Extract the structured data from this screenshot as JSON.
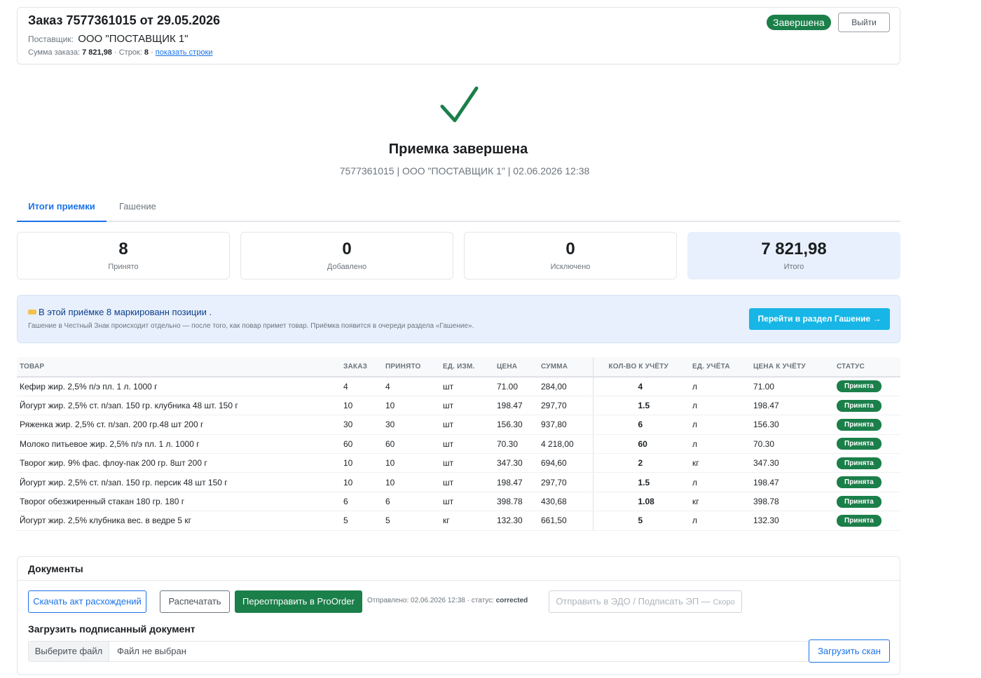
{
  "header": {
    "order_title": "Заказ 7577361015 от 29.05.2026",
    "supplier_label": "Поставщик:",
    "supplier_name": "ООО \"ПОСТАВЩИК 1\"",
    "sum_label": "Сумма заказа:",
    "sum_value": "7 821,98",
    "rows_label": "· Строк:",
    "rows_value": "8",
    "show_rows_link": "показать строки",
    "status": "Завершена",
    "logout": "Выйти"
  },
  "done": {
    "title": "Приемка завершена",
    "subtitle": "7577361015 | ООО \"ПОСТАВЩИК 1\" | 02.06.2026 12:38"
  },
  "tabs": [
    {
      "label": "Итоги приемки",
      "active": true
    },
    {
      "label": "Гашение",
      "active": false
    }
  ],
  "stats": [
    {
      "value": "8",
      "label": "Принято"
    },
    {
      "value": "0",
      "label": "Добавлено"
    },
    {
      "value": "0",
      "label": "Исключено"
    },
    {
      "value": "7 821,98",
      "label": "Итого"
    }
  ],
  "banner": {
    "line1": "В этой приёмке 8 маркированн позиции .",
    "line2": "Гашение в Честный Знак происходит отдельно — после того, как повар примет товар. Приёмка появится в очереди раздела «Гашение».",
    "button": "Перейти в раздел Гашение →"
  },
  "table": {
    "headers": [
      "ТОВАР",
      "ЗАКАЗ",
      "ПРИНЯТО",
      "ЕД. ИЗМ.",
      "ЦЕНА",
      "СУММА",
      "КОЛ-ВО К УЧЁТУ",
      "ЕД. УЧЁТА",
      "ЦЕНА К УЧЁТУ",
      "СТАТУС"
    ],
    "rows": [
      {
        "name": "Кефир жир. 2,5% п/э пл. 1 л. 1000 г",
        "order": "4",
        "accepted": "4",
        "unit": "шт",
        "price": "71.00",
        "sum": "284,00",
        "qty": "4",
        "acc_unit": "л",
        "acc_price": "71.00",
        "status": "Принята"
      },
      {
        "name": "Йогурт жир. 2,5% ст. п/зап. 150 гр. клубника 48 шт. 150 г",
        "order": "10",
        "accepted": "10",
        "unit": "шт",
        "price": "198.47",
        "sum": "297,70",
        "qty": "1.5",
        "acc_unit": "л",
        "acc_price": "198.47",
        "status": "Принята"
      },
      {
        "name": "Ряженка жир. 2,5% ст. п/зап. 200 гр.48 шт 200 г",
        "order": "30",
        "accepted": "30",
        "unit": "шт",
        "price": "156.30",
        "sum": "937,80",
        "qty": "6",
        "acc_unit": "л",
        "acc_price": "156.30",
        "status": "Принята"
      },
      {
        "name": "Молоко питьевое жир. 2,5% п/э пл. 1 л. 1000 г",
        "order": "60",
        "accepted": "60",
        "unit": "шт",
        "price": "70.30",
        "sum": "4 218,00",
        "qty": "60",
        "acc_unit": "л",
        "acc_price": "70.30",
        "status": "Принята"
      },
      {
        "name": "Творог жир. 9% фас. флоу-пак 200 гр. 8шт 200 г",
        "order": "10",
        "accepted": "10",
        "unit": "шт",
        "price": "347.30",
        "sum": "694,60",
        "qty": "2",
        "acc_unit": "кг",
        "acc_price": "347.30",
        "status": "Принята"
      },
      {
        "name": "Йогурт жир. 2,5% ст. п/зап. 150 гр. персик 48 шт 150 г",
        "order": "10",
        "accepted": "10",
        "unit": "шт",
        "price": "198.47",
        "sum": "297,70",
        "qty": "1.5",
        "acc_unit": "л",
        "acc_price": "198.47",
        "status": "Принята"
      },
      {
        "name": "Творог обезжиренный стакан 180 гр. 180 г",
        "order": "6",
        "accepted": "6",
        "unit": "шт",
        "price": "398.78",
        "sum": "430,68",
        "qty": "1.08",
        "acc_unit": "кг",
        "acc_price": "398.78",
        "status": "Принята"
      },
      {
        "name": "Йогурт жир. 2,5% клубника вес. в ведре 5 кг",
        "order": "5",
        "accepted": "5",
        "unit": "кг",
        "price": "132.30",
        "sum": "661,50",
        "qty": "5",
        "acc_unit": "л",
        "acc_price": "132.30",
        "status": "Принята"
      }
    ]
  },
  "documents": {
    "title": "Документы",
    "download_act": "Скачать акт расхождений",
    "print": "Распечатать",
    "resend": "Переотправить в ProOrder",
    "sent_label": "Отправлено: 02.06.2026 12:38 · статус:",
    "sent_status": "corrected",
    "edo_button": "Отправить в ЭДО / Подписать ЭП —",
    "edo_soon": "Скоро",
    "upload_title": "Загрузить подписанный документ",
    "choose_file": "Выберите файл",
    "no_file": "Файл не выбран",
    "upload_scan": "Загрузить скан"
  },
  "colors": {
    "accent": "#1a73e8",
    "success": "#1b7f4a",
    "info_bg": "#e8f0fd",
    "cta": "#17b6e6"
  }
}
